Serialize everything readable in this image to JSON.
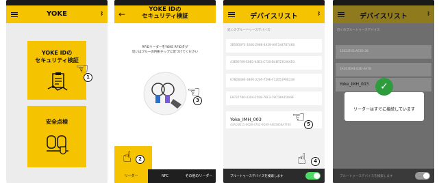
{
  "screen1": {
    "title": "YOKE",
    "card1": {
      "label_line1": "YOKE IDの",
      "label_line2": "セキュリティ検証"
    },
    "card2": {
      "label": "安全点検"
    },
    "step": "1"
  },
  "screen2": {
    "title_line1": "YOKE IDの",
    "title_line2": "セキュリティ検証",
    "instruction_line1": "RFIDリーダーをYOKE RFIDタグ",
    "instruction_line2": "近いはブルーの円形チップに近づけてください",
    "step_scan": "3",
    "step_tab": "2",
    "tabs": [
      "リーダー",
      "NFC",
      "その他のリーダー"
    ]
  },
  "screen3": {
    "title": "デバイスリスト",
    "list_header": "近くのブルートゥースデバイス",
    "uuids": [
      "3B59D0F3-1666-2988-4458-A0F344787468",
      "43E8EF89-E085-45B1-C730-B48F53C064D3",
      "678D6480-3800-226F-759E-F12B51PRE238",
      "E9737780-4304-2508-76F3-79C59A45049F"
    ],
    "device_name": "Yoke_IMH_003",
    "device_id": "43AC6D11-6628-4762-9D49-A0E5B08A7F0E",
    "bottom_label": "ブルートゥースデバイスを検索します",
    "step_device": "5",
    "step_toggle": "4"
  },
  "screen4": {
    "title": "デバイスリスト",
    "list_header": "近くのブルートゥースデバイス",
    "rows": [
      "1E022F05-AE3D-38",
      "1A103D94-E3D-4A78",
      "Yoke_IMH_003"
    ],
    "dialog_text": "リーダーはすでに接続しています",
    "bottom_label": "ブルートゥースデバイスを検索します"
  },
  "colors": {
    "accent": "#f6c300",
    "success": "#2e9c3d"
  }
}
